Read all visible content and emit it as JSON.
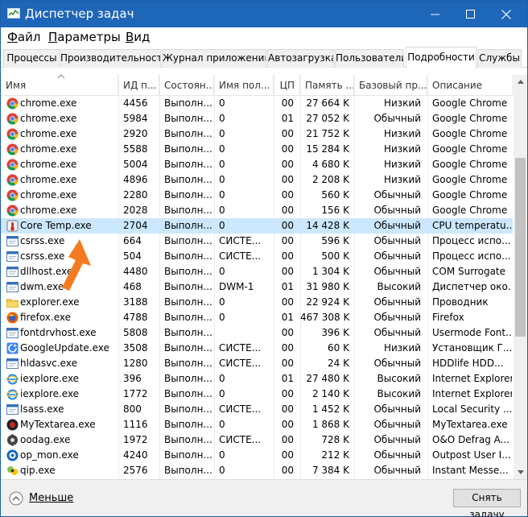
{
  "window": {
    "title": "Диспетчер задач",
    "colors": {
      "titlebar": "#1e66b8",
      "selection": "#cce8ff",
      "arrow": "#f47b20"
    }
  },
  "menu": [
    {
      "label": "Файл",
      "accel": "Ф",
      "rest": "айл"
    },
    {
      "label": "Параметры",
      "accel": "П",
      "rest": "араметры"
    },
    {
      "label": "Вид",
      "accel": "В",
      "rest": "ид"
    }
  ],
  "tabs": [
    {
      "label": "Процессы",
      "active": false
    },
    {
      "label": "Производительность",
      "active": false
    },
    {
      "label": "Журнал приложений",
      "active": false
    },
    {
      "label": "Автозагрузка",
      "active": false
    },
    {
      "label": "Пользователи",
      "active": false
    },
    {
      "label": "Подробности",
      "active": true
    },
    {
      "label": "Службы",
      "active": false
    }
  ],
  "columns": [
    "Имя",
    "ИД п...",
    "Состоян...",
    "Имя пол...",
    "ЦП",
    "Память ...",
    "Базовый пр...",
    "Описание"
  ],
  "rows": [
    {
      "icon": "chrome-icon",
      "name": "chrome.exe",
      "pid": "4456",
      "status": "Выполн...",
      "user": "0",
      "cpu": "00",
      "mem": "27 664 K",
      "prio": "Низкий",
      "desc": "Google Chrome"
    },
    {
      "icon": "chrome-icon",
      "name": "chrome.exe",
      "pid": "5984",
      "status": "Выполн...",
      "user": "0",
      "cpu": "01",
      "mem": "27 052 K",
      "prio": "Обычный",
      "desc": "Google Chrome"
    },
    {
      "icon": "chrome-icon",
      "name": "chrome.exe",
      "pid": "2920",
      "status": "Выполн...",
      "user": "0",
      "cpu": "00",
      "mem": "21 752 K",
      "prio": "Низкий",
      "desc": "Google Chrome"
    },
    {
      "icon": "chrome-icon",
      "name": "chrome.exe",
      "pid": "5588",
      "status": "Выполн...",
      "user": "0",
      "cpu": "00",
      "mem": "15 284 K",
      "prio": "Низкий",
      "desc": "Google Chrome"
    },
    {
      "icon": "chrome-icon",
      "name": "chrome.exe",
      "pid": "5004",
      "status": "Выполн...",
      "user": "0",
      "cpu": "00",
      "mem": "4 680 K",
      "prio": "Низкий",
      "desc": "Google Chrome"
    },
    {
      "icon": "chrome-icon",
      "name": "chrome.exe",
      "pid": "4896",
      "status": "Выполн...",
      "user": "0",
      "cpu": "00",
      "mem": "2 208 K",
      "prio": "Низкий",
      "desc": "Google Chrome"
    },
    {
      "icon": "chrome-icon",
      "name": "chrome.exe",
      "pid": "2280",
      "status": "Выполн...",
      "user": "0",
      "cpu": "00",
      "mem": "560 K",
      "prio": "Обычный",
      "desc": "Google Chrome"
    },
    {
      "icon": "chrome-icon",
      "name": "chrome.exe",
      "pid": "2028",
      "status": "Выполн...",
      "user": "0",
      "cpu": "00",
      "mem": "156 K",
      "prio": "Обычный",
      "desc": "Google Chrome"
    },
    {
      "icon": "core-temp-icon",
      "name": "Core Temp.exe",
      "pid": "2704",
      "status": "Выполн...",
      "user": "0",
      "cpu": "00",
      "mem": "14 428 K",
      "prio": "Обычный",
      "desc": "CPU temperatu...",
      "selected": true
    },
    {
      "icon": "window-icon",
      "name": "csrss.exe",
      "pid": "664",
      "status": "Выполн...",
      "user": "СИСТЕ...",
      "cpu": "00",
      "mem": "596 K",
      "prio": "Обычный",
      "desc": "Процесс испо..."
    },
    {
      "icon": "window-icon",
      "name": "csrss.exe",
      "pid": "504",
      "status": "Выполн...",
      "user": "СИСТЕ...",
      "cpu": "00",
      "mem": "500 K",
      "prio": "Обычный",
      "desc": "Процесс испо..."
    },
    {
      "icon": "window-icon",
      "name": "dllhost.exe",
      "pid": "4480",
      "status": "Выполн...",
      "user": "0",
      "cpu": "00",
      "mem": "1 304 K",
      "prio": "Обычный",
      "desc": "COM Surrogate"
    },
    {
      "icon": "window-icon",
      "name": "dwm.exe",
      "pid": "468",
      "status": "Выполн...",
      "user": "DWM-1",
      "cpu": "01",
      "mem": "31 980 K",
      "prio": "Высокий",
      "desc": "Диспетчер око..."
    },
    {
      "icon": "explorer-icon",
      "name": "explorer.exe",
      "pid": "3188",
      "status": "Выполн...",
      "user": "0",
      "cpu": "00",
      "mem": "22 924 K",
      "prio": "Обычный",
      "desc": "Проводник"
    },
    {
      "icon": "firefox-icon",
      "name": "firefox.exe",
      "pid": "4788",
      "status": "Выполн...",
      "user": "0",
      "cpu": "01",
      "mem": "467 308 K",
      "prio": "Обычный",
      "desc": "Firefox"
    },
    {
      "icon": "window-icon",
      "name": "fontdrvhost.exe",
      "pid": "5808",
      "status": "Выполн...",
      "user": "",
      "cpu": "00",
      "mem": "396 K",
      "prio": "Обычный",
      "desc": "Usermode Font..."
    },
    {
      "icon": "google-update-icon",
      "name": "GoogleUpdate.exe",
      "pid": "3508",
      "status": "Выполн...",
      "user": "СИСТЕ...",
      "cpu": "00",
      "mem": "60 K",
      "prio": "Низкий",
      "desc": "Установщик Г..."
    },
    {
      "icon": "window-icon",
      "name": "hldasvc.exe",
      "pid": "1280",
      "status": "Выполн...",
      "user": "СИСТЕ...",
      "cpu": "00",
      "mem": "24 K",
      "prio": "Обычный",
      "desc": "HDDlife HDD..."
    },
    {
      "icon": "ie-icon",
      "name": "iexplore.exe",
      "pid": "396",
      "status": "Выполн...",
      "user": "0",
      "cpu": "01",
      "mem": "27 480 K",
      "prio": "Высокий",
      "desc": "Internet Explorer"
    },
    {
      "icon": "ie-icon",
      "name": "iexplore.exe",
      "pid": "1772",
      "status": "Выполн...",
      "user": "0",
      "cpu": "00",
      "mem": "2 140 K",
      "prio": "Высокий",
      "desc": "Internet Explorer"
    },
    {
      "icon": "window-icon",
      "name": "lsass.exe",
      "pid": "800",
      "status": "Выполн...",
      "user": "СИСТЕ...",
      "cpu": "00",
      "mem": "1 452 K",
      "prio": "Обычный",
      "desc": "Local Security ..."
    },
    {
      "icon": "mytextarea-icon",
      "name": "MyTextarea.exe",
      "pid": "1116",
      "status": "Выполн...",
      "user": "0",
      "cpu": "00",
      "mem": "1 868 K",
      "prio": "Обычный",
      "desc": "MyTextarea.exe"
    },
    {
      "icon": "oodag-icon",
      "name": "oodag.exe",
      "pid": "1972",
      "status": "Выполн...",
      "user": "СИСТЕ...",
      "cpu": "00",
      "mem": "728 K",
      "prio": "Обычный",
      "desc": "O&O Defrag A..."
    },
    {
      "icon": "op-mon-icon",
      "name": "op_mon.exe",
      "pid": "4240",
      "status": "Выполн...",
      "user": "0",
      "cpu": "00",
      "mem": "212 K",
      "prio": "Обычный",
      "desc": "Outpost User I..."
    },
    {
      "icon": "qip-icon",
      "name": "qip.exe",
      "pid": "2576",
      "status": "Выполн...",
      "user": "0",
      "cpu": "00",
      "mem": "7 384 K",
      "prio": "Обычный",
      "desc": "Instant Messe..."
    }
  ],
  "footer": {
    "less_label": "Меньше",
    "end_task_label": "Снять задачу"
  }
}
